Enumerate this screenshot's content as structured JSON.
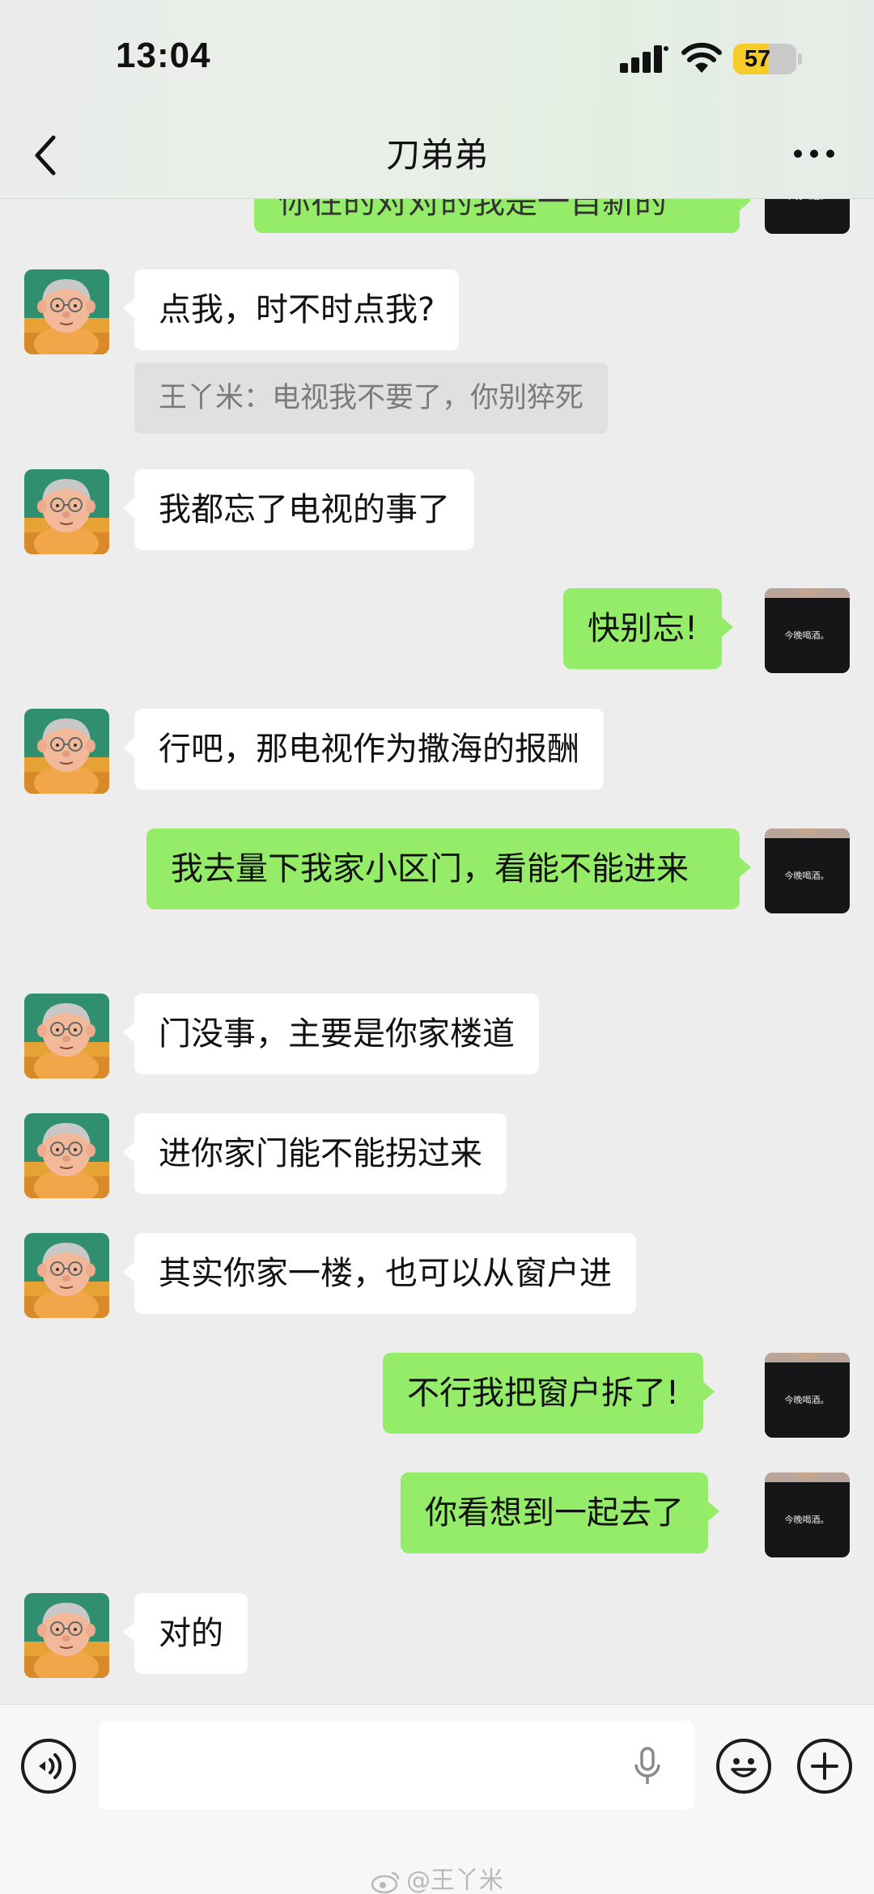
{
  "status_bar": {
    "time": "13:04",
    "battery": "57",
    "battery_level": 0.57
  },
  "header": {
    "title": "刀弟弟"
  },
  "messages": [
    {
      "side": "out",
      "text": "你在的对对的我是一自新的",
      "partial": true
    },
    {
      "side": "in",
      "text": "点我，时不时点我?"
    },
    {
      "side": "quote",
      "text": "王丫米：电视我不要了，你别猝死"
    },
    {
      "side": "in",
      "text": "我都忘了电视的事了"
    },
    {
      "side": "out",
      "text": "快别忘!"
    },
    {
      "side": "in",
      "text": "行吧，那电视作为撒海的报酬"
    },
    {
      "side": "out",
      "text": "我去量下我家小区门，看能不能进来"
    },
    {
      "side": "in",
      "text": "门没事，主要是你家楼道"
    },
    {
      "side": "in",
      "text": "进你家门能不能拐过来"
    },
    {
      "side": "in",
      "text": "其实你家一楼，也可以从窗户进"
    },
    {
      "side": "out",
      "text": "不行我把窗户拆了!"
    },
    {
      "side": "out",
      "text": "你看想到一起去了"
    },
    {
      "side": "in",
      "text": "对的"
    }
  ],
  "avatars": {
    "contact": "cartoon-grandpa-avatar",
    "self": "black-shirt-avatar",
    "self_shirt_text": "今晚喝酒。"
  },
  "input_bar": {
    "value": "",
    "icons": [
      "voice-icon",
      "mic-icon",
      "emoji-icon",
      "add-icon"
    ]
  },
  "watermark": "@王丫米",
  "colors": {
    "bubble_out": "#95ec69",
    "bubble_in": "#ffffff",
    "background": "#ededed"
  }
}
